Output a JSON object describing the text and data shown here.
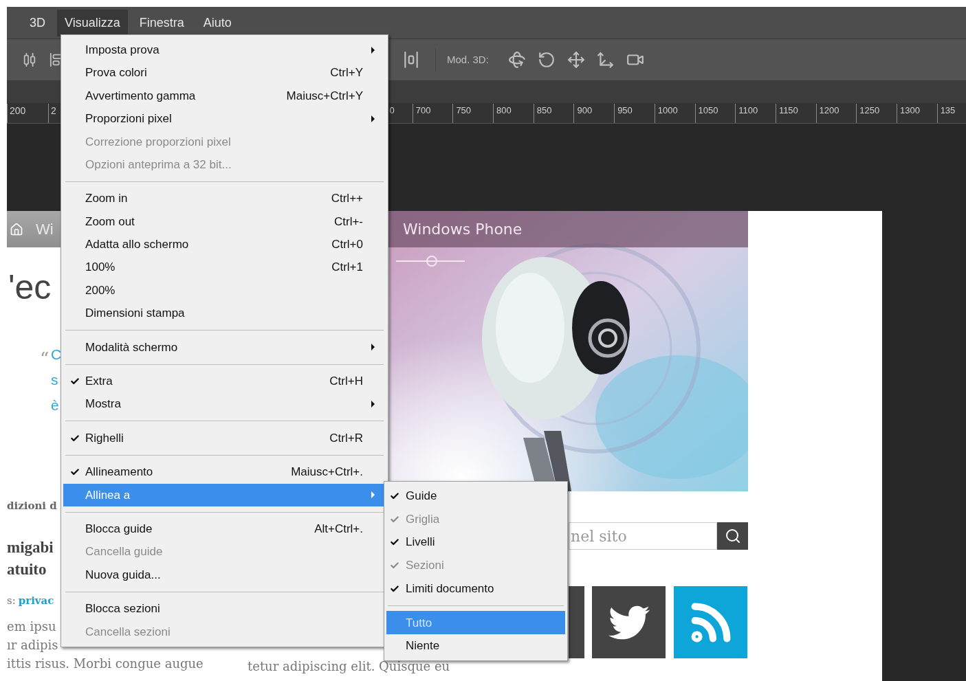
{
  "menu_bar": [
    {
      "label": "3D",
      "selected": false
    },
    {
      "label": "Visualizza",
      "selected": true
    },
    {
      "label": "Finestra",
      "selected": false
    },
    {
      "label": "Aiuto",
      "selected": false
    }
  ],
  "toolbar": {
    "mode_label": "Mod. 3D:"
  },
  "ruler": {
    "left_labels": [
      "200",
      "2"
    ],
    "right_labels": [
      "0",
      "700",
      "750",
      "800",
      "850",
      "900",
      "950",
      "1000",
      "1050",
      "1100",
      "1150",
      "1200",
      "1250",
      "1300",
      "135"
    ]
  },
  "document": {
    "nav_text": "Wi",
    "banner_title": "Windows Phone",
    "heading_fragment": "'ec",
    "quote_mark": "“",
    "quote_lines": [
      "C",
      "s",
      "è"
    ],
    "caption_fragment": "dizioni d",
    "title_lines": [
      "migabi",
      "atuito"
    ],
    "tags_prefix": "s:",
    "tags_link": "privac",
    "body_lines": [
      "em ipsu",
      "ır adipis",
      "ittis risus. Morbi congue augue"
    ],
    "middle_line": "tetur adipiscing elit. Quisque eu",
    "search_placeholder": "nel sito"
  },
  "menu": {
    "items": [
      {
        "kind": "item",
        "label": "Imposta prova",
        "submenu": true,
        "checked": false,
        "disabled": false,
        "selected": false
      },
      {
        "kind": "item",
        "label": "Prova colori",
        "shortcut": "Ctrl+Y",
        "submenu": false,
        "checked": false,
        "disabled": false,
        "selected": false
      },
      {
        "kind": "item",
        "label": "Avvertimento gamma",
        "shortcut": "Maiusc+Ctrl+Y",
        "submenu": false,
        "checked": false,
        "disabled": false,
        "selected": false
      },
      {
        "kind": "item",
        "label": "Proporzioni pixel",
        "submenu": true,
        "checked": false,
        "disabled": false,
        "selected": false
      },
      {
        "kind": "item",
        "label": "Correzione proporzioni pixel",
        "submenu": false,
        "checked": false,
        "disabled": true,
        "selected": false
      },
      {
        "kind": "item",
        "label": "Opzioni anteprima a 32 bit...",
        "submenu": false,
        "checked": false,
        "disabled": true,
        "selected": false
      },
      {
        "kind": "separator"
      },
      {
        "kind": "item",
        "label": "Zoom in",
        "shortcut": "Ctrl++",
        "submenu": false,
        "checked": false,
        "disabled": false,
        "selected": false
      },
      {
        "kind": "item",
        "label": "Zoom out",
        "shortcut": "Ctrl+-",
        "submenu": false,
        "checked": false,
        "disabled": false,
        "selected": false
      },
      {
        "kind": "item",
        "label": "Adatta allo schermo",
        "shortcut": "Ctrl+0",
        "submenu": false,
        "checked": false,
        "disabled": false,
        "selected": false
      },
      {
        "kind": "item",
        "label": "100%",
        "shortcut": "Ctrl+1",
        "submenu": false,
        "checked": false,
        "disabled": false,
        "selected": false
      },
      {
        "kind": "item",
        "label": "200%",
        "submenu": false,
        "checked": false,
        "disabled": false,
        "selected": false
      },
      {
        "kind": "item",
        "label": "Dimensioni stampa",
        "submenu": false,
        "checked": false,
        "disabled": false,
        "selected": false
      },
      {
        "kind": "separator"
      },
      {
        "kind": "item",
        "label": "Modalità schermo",
        "submenu": true,
        "checked": false,
        "disabled": false,
        "selected": false
      },
      {
        "kind": "separator"
      },
      {
        "kind": "item",
        "label": "Extra",
        "shortcut": "Ctrl+H",
        "submenu": false,
        "checked": true,
        "disabled": false,
        "selected": false
      },
      {
        "kind": "item",
        "label": "Mostra",
        "submenu": true,
        "checked": false,
        "disabled": false,
        "selected": false
      },
      {
        "kind": "separator"
      },
      {
        "kind": "item",
        "label": "Righelli",
        "shortcut": "Ctrl+R",
        "submenu": false,
        "checked": true,
        "disabled": false,
        "selected": false
      },
      {
        "kind": "separator"
      },
      {
        "kind": "item",
        "label": "Allineamento",
        "shortcut": "Maiusc+Ctrl+.",
        "submenu": false,
        "checked": true,
        "disabled": false,
        "selected": false
      },
      {
        "kind": "item",
        "label": "Allinea a",
        "submenu": true,
        "checked": false,
        "disabled": false,
        "selected": true
      },
      {
        "kind": "separator"
      },
      {
        "kind": "item",
        "label": "Blocca guide",
        "shortcut": "Alt+Ctrl+.",
        "submenu": false,
        "checked": false,
        "disabled": false,
        "selected": false
      },
      {
        "kind": "item",
        "label": "Cancella guide",
        "submenu": false,
        "checked": false,
        "disabled": true,
        "selected": false
      },
      {
        "kind": "item",
        "label": "Nuova guida...",
        "submenu": false,
        "checked": false,
        "disabled": false,
        "selected": false
      },
      {
        "kind": "separator"
      },
      {
        "kind": "item",
        "label": "Blocca sezioni",
        "submenu": false,
        "checked": false,
        "disabled": false,
        "selected": false
      },
      {
        "kind": "item",
        "label": "Cancella sezioni",
        "submenu": false,
        "checked": false,
        "disabled": true,
        "selected": false
      }
    ]
  },
  "submenu": {
    "items": [
      {
        "kind": "item",
        "label": "Guide",
        "checked": true,
        "disabled": false,
        "selected": false
      },
      {
        "kind": "item",
        "label": "Griglia",
        "checked": true,
        "disabled": true,
        "selected": false
      },
      {
        "kind": "item",
        "label": "Livelli",
        "checked": true,
        "disabled": false,
        "selected": false
      },
      {
        "kind": "item",
        "label": "Sezioni",
        "checked": true,
        "disabled": true,
        "selected": false
      },
      {
        "kind": "item",
        "label": "Limiti documento",
        "checked": true,
        "disabled": false,
        "selected": false
      },
      {
        "kind": "separator"
      },
      {
        "kind": "item",
        "label": "Tutto",
        "checked": false,
        "disabled": true,
        "selected": true
      },
      {
        "kind": "item",
        "label": "Niente",
        "checked": false,
        "disabled": false,
        "selected": false
      }
    ]
  }
}
